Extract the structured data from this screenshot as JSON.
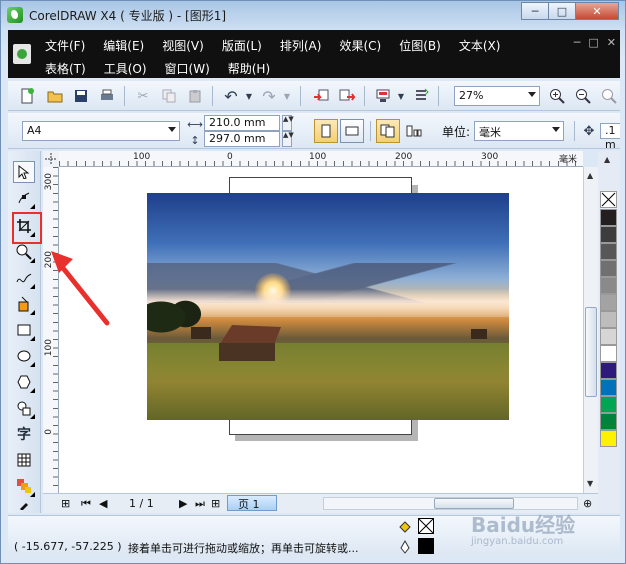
{
  "window": {
    "title": "CorelDRAW X4 ( 专业版 ) - [图形1]",
    "minimize_glyph": "─",
    "maximize_glyph": "□",
    "close_glyph": "✕"
  },
  "menubar": {
    "row1": [
      "文件(F)",
      "编辑(E)",
      "视图(V)",
      "版面(L)",
      "排列(A)",
      "效果(C)",
      "位图(B)",
      "文本(X)"
    ],
    "row2": [
      "表格(T)",
      "工具(O)",
      "窗口(W)",
      "帮助(H)"
    ],
    "mdi_controls": [
      "─",
      "□",
      "✕"
    ]
  },
  "standard_toolbar": {
    "zoom_value": "27%"
  },
  "property_bar": {
    "paper_size": "A4",
    "width": "210.0 mm",
    "height": "297.0 mm",
    "units_label": "单位:",
    "units_value": "毫米",
    "nudge_value": ".1 m"
  },
  "toolbox": {
    "text_tool_glyph": "字"
  },
  "rulers": {
    "top_ticks": [
      "100",
      "0",
      "100",
      "200",
      "300"
    ],
    "top_unit": "毫米",
    "left_ticks": [
      "300",
      "200",
      "100",
      "0"
    ]
  },
  "page_nav": {
    "page_count": "1 / 1",
    "page_tab": "页 1"
  },
  "status": {
    "coordinates": "( -15.677, -57.225 )",
    "hint": "接着单击可进行拖动或缩放；再单击可旋转或..."
  },
  "palette": {
    "colors": [
      "#231f20",
      "#3d3d3d",
      "#575757",
      "#707070",
      "#8a8a8a",
      "#a3a3a3",
      "#bdbdbd",
      "#d6d6d6",
      "#ffffff",
      "#2e1a7a",
      "#0072bc",
      "#00a651",
      "#00843d",
      "#fff200"
    ]
  },
  "watermark": {
    "brand": "Baidu经验",
    "site": "jingyan.baidu.com"
  },
  "accent": {
    "highlight": "#e8312c"
  }
}
